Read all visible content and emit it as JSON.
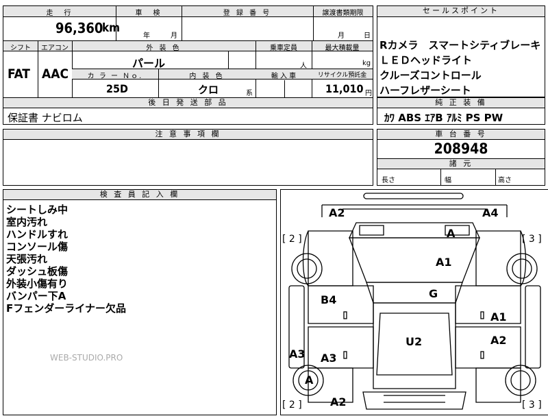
{
  "top_table": {
    "mileage_header": "走　行",
    "mileage_value": "96,360",
    "mileage_unit": "km",
    "inspection_header": "車　検",
    "inspection_year": "年",
    "inspection_month": "月",
    "registration_header": "登 録 番 号",
    "transfer_header": "譲渡書類期限",
    "transfer_month": "月",
    "transfer_day": "日",
    "shift_header": "シフト",
    "shift_value": "FAT",
    "aircon_header": "エアコン",
    "aircon_value": "AAC",
    "exterior_color_header": "外 装 色",
    "exterior_color_value": "パール",
    "capacity_header": "乗車定員",
    "capacity_unit": "人",
    "max_load_header": "最大積載量",
    "max_load_unit": "kg",
    "color_no_header": "カ ラ ー Ｎｏ.",
    "color_no_value": "25D",
    "interior_color_header": "内 装 色",
    "interior_color_value": "クロ",
    "interior_color_suffix": "系",
    "import_header": "輸 入 車",
    "recycle_header": "リサイクル預託金",
    "recycle_value": "11,010",
    "recycle_unit": "円",
    "later_parts_header": "後 日 発 送 部 品",
    "later_parts_value": "保証書 ナビロム"
  },
  "sales_points": {
    "header": "セールスポイント",
    "lines": [
      "Rカメラ　スマートシティブレーキ",
      "ＬＥＤヘッドライト",
      "クルーズコントロール",
      "ハーフレザーシート"
    ]
  },
  "standard_equipment": {
    "header": "純 正 装 備",
    "value": "ｶﾜ ABS ｴｱB ｱﾙﾐ PS PW"
  },
  "notes": {
    "header": "注 意 事 項 欄"
  },
  "chassis": {
    "header": "車 台 番 号",
    "value": "208948"
  },
  "dimensions": {
    "header": "諸 元",
    "length": "長さ",
    "width": "幅",
    "height": "高さ"
  },
  "inspector": {
    "header": "検 査 員 記 入 欄",
    "lines": [
      "シートしみ中",
      "室内汚れ",
      "ハンドルすれ",
      "コンソール傷",
      "天張汚れ",
      "ダッシュ板傷",
      "外装小傷有り",
      "バンパー下A",
      "Fフェンダーライナー欠品"
    ],
    "watermark": "WEB-STUDIO.PRO"
  },
  "diagram": {
    "bracket_left_top": "[ 2 ]",
    "bracket_right_top": "[ 3 ]",
    "bracket_left_bottom": "[ 2 ]",
    "bracket_right_bottom": "[ 3 ]",
    "labels": {
      "front_left": "A2",
      "front_right": "A4",
      "hood": "A",
      "windshield": "A1",
      "roof": "G",
      "left_front_door": "B4",
      "right_front_door": "A1",
      "left_rear_door": "A3",
      "right_rear_door": "A2",
      "left_side_sill": "A3",
      "rear_window": "U2",
      "left_rear_wheel": "A",
      "rear_bumper": "A2"
    }
  }
}
